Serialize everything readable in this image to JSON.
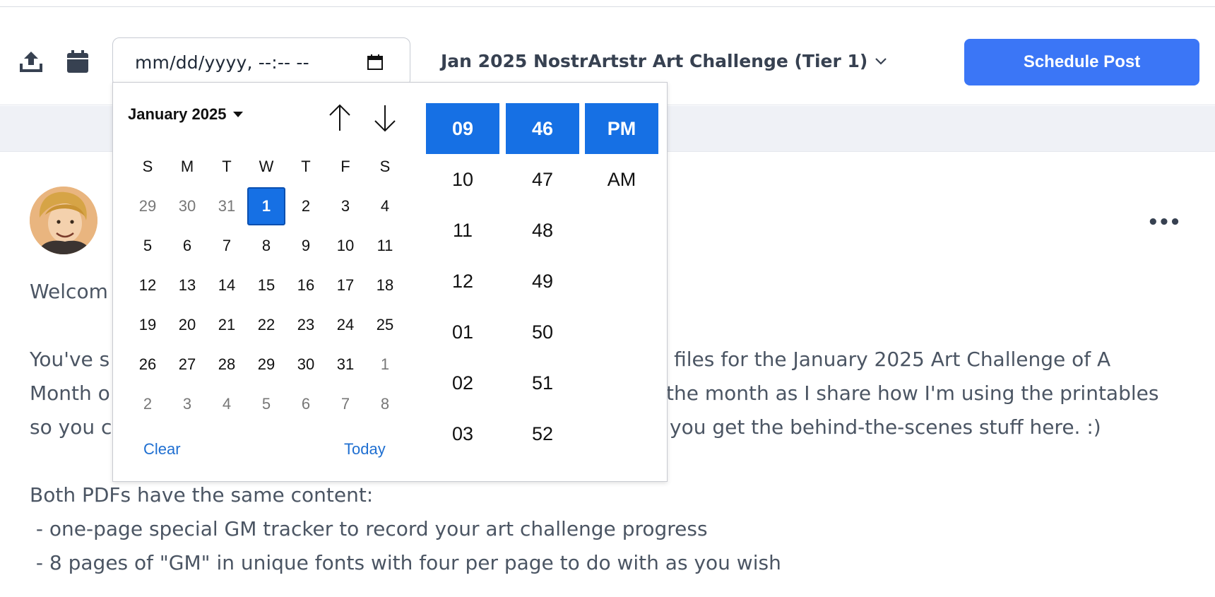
{
  "toolbar": {
    "upload_icon": "upload-icon",
    "calendar_icon": "calendar-icon",
    "datetime_placeholder": "mm/dd/yyyy, --:-- --",
    "challenge_label": "Jan 2025 NostrArtstr Art Challenge (Tier 1)",
    "schedule_label": "Schedule Post"
  },
  "post": {
    "more_label": "•••",
    "visible_lines": [
      "Welcom",
      "You've s",
      "e files for the January 2025 Art Challenge of A",
      "Month o",
      "the month as I share how I'm using the printables",
      "so you c",
      "you get the behind-the-scenes stuff here. :)",
      "Both PDFs have the same content:",
      " - one-page special GM tracker to record your art challenge progress",
      " - 8 pages of \"GM\" in unique fonts with four per page to do with as you wish"
    ]
  },
  "picker": {
    "month_label": "January 2025",
    "weekdays": [
      "S",
      "M",
      "T",
      "W",
      "T",
      "F",
      "S"
    ],
    "weeks": [
      [
        "29",
        "30",
        "31",
        "1",
        "2",
        "3",
        "4"
      ],
      [
        "5",
        "6",
        "7",
        "8",
        "9",
        "10",
        "11"
      ],
      [
        "12",
        "13",
        "14",
        "15",
        "16",
        "17",
        "18"
      ],
      [
        "19",
        "20",
        "21",
        "22",
        "23",
        "24",
        "25"
      ],
      [
        "26",
        "27",
        "28",
        "29",
        "30",
        "31",
        "1"
      ],
      [
        "2",
        "3",
        "4",
        "5",
        "6",
        "7",
        "8"
      ]
    ],
    "selected_day": "1",
    "clear_label": "Clear",
    "today_label": "Today",
    "hours": [
      "09",
      "10",
      "11",
      "12",
      "01",
      "02",
      "03"
    ],
    "minutes": [
      "46",
      "47",
      "48",
      "49",
      "50",
      "51",
      "52"
    ],
    "ampm": [
      "PM",
      "AM"
    ]
  },
  "colors": {
    "accent": "#3b76f6",
    "picker_selected": "#1670e4",
    "link": "#1f6fd1"
  }
}
